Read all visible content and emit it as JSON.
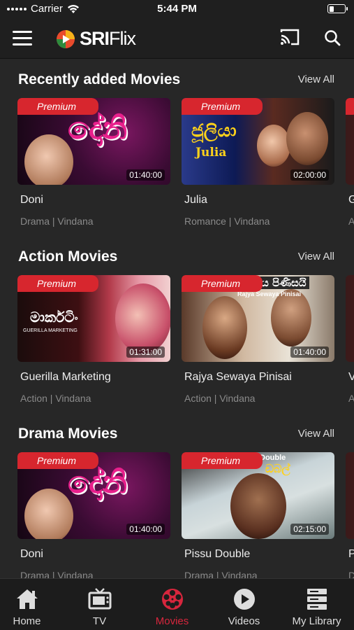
{
  "status_bar": {
    "carrier": "Carrier",
    "time": "5:44 PM",
    "battery_level": 0.3
  },
  "header": {
    "logo": {
      "text_bold": "SRI",
      "text_light": "Flix"
    },
    "icons": {
      "menu": "hamburger-icon",
      "cast": "cast-icon",
      "search": "search-icon"
    }
  },
  "sections": [
    {
      "title": "Recently added Movies",
      "view_all": "View All",
      "items": [
        {
          "badge": "Premium",
          "duration": "01:40:00",
          "title": "Doni",
          "meta": "Drama | Vindana",
          "thumb_text": "දෝනි"
        },
        {
          "badge": "Premium",
          "duration": "02:00:00",
          "title": "Julia",
          "meta": "Romance | Vindana",
          "thumb_text": "ජූලියා",
          "thumb_text2": "Julia"
        },
        {
          "title": "G",
          "meta": "A"
        }
      ]
    },
    {
      "title": "Action Movies",
      "view_all": "View All",
      "items": [
        {
          "badge": "Premium",
          "duration": "01:31:00",
          "title": "Guerilla Marketing",
          "meta": "Action | Vindana",
          "thumb_text": "මාර්කටිං",
          "thumb_text2": "GUERILLA MARKETING"
        },
        {
          "badge": "Premium",
          "duration": "01:40:00",
          "title": "Rajya Sewaya Pinisai",
          "meta": "Action | Vindana",
          "thumb_text": "ය පිණිසයි",
          "thumb_text2": "Rajya Sewaya Pinisai"
        },
        {
          "title": "V",
          "meta": "A"
        }
      ]
    },
    {
      "title": "Drama Movies",
      "view_all": "View All",
      "items": [
        {
          "badge": "Premium",
          "duration": "01:40:00",
          "title": "Doni",
          "meta": "Drama | Vindana",
          "thumb_text": "දෝනි"
        },
        {
          "badge": "Premium",
          "duration": "02:15:00",
          "title": "Pissu Double",
          "meta": "Drama | Vindana",
          "thumb_text": "Double",
          "thumb_text2": "ඩබල්"
        },
        {
          "title": "P",
          "meta": "D"
        }
      ]
    }
  ],
  "tabs": [
    {
      "label": "Home",
      "icon": "home-icon"
    },
    {
      "label": "TV",
      "icon": "tv-icon"
    },
    {
      "label": "Movies",
      "icon": "film-reel-icon",
      "active": true
    },
    {
      "label": "Videos",
      "icon": "play-circle-icon"
    },
    {
      "label": "My Library",
      "icon": "server-stack-icon"
    }
  ],
  "colors": {
    "accent": "#d7263d",
    "badge": "#d7262e",
    "background": "#272727",
    "bar": "#1f1f1f"
  }
}
